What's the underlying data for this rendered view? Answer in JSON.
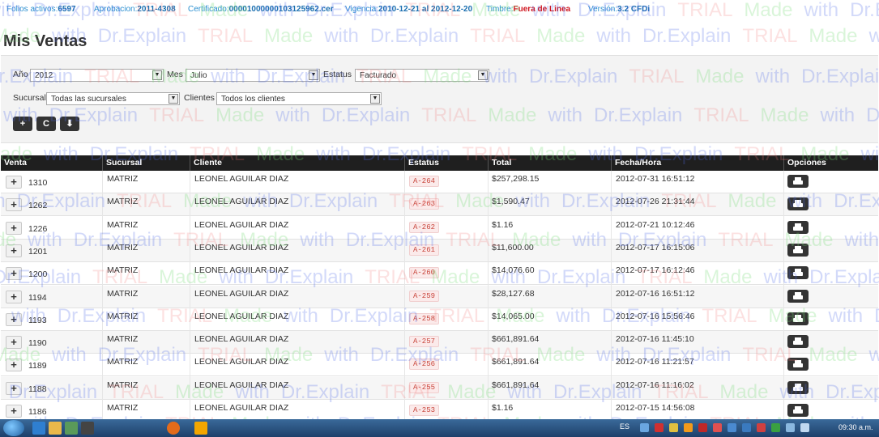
{
  "info": {
    "folios_label": "Folios activos:",
    "folios_value": "6597",
    "aprobacion_label": "Aprobacion:",
    "aprobacion_value": "2011-4308",
    "certificado_label": "Certificado:",
    "certificado_value": "00001000000103125962.cer",
    "vigencia_label": "Vigencia:",
    "vigencia_value": "2010-12-21 al 2012-12-20",
    "timbre_label": "Timbre:",
    "timbre_value": "Fuera de Linea",
    "version_label": "Versión:",
    "version_value": "3.2 CFDi"
  },
  "watermark": {
    "made": "Made",
    "with": "with",
    "drexplain": "Dr.Explain",
    "trial": "TRIAL"
  },
  "page_title": "Mis Ventas",
  "filters": {
    "anio_label": "Año",
    "anio_value": "2012",
    "mes_label": "Mes",
    "mes_value": "Julio",
    "estatus_label": "Estatus",
    "estatus_value": "Facturado",
    "sucursal_label": "Sucursal",
    "sucursal_value": "Todas las sucursales",
    "clientes_label": "Clientes",
    "clientes_value": "Todos los clientes"
  },
  "toolbar": {
    "add_glyph": "+",
    "refresh_glyph": "C",
    "download_glyph": "⬇"
  },
  "table": {
    "headers": [
      "Venta",
      "Sucursal",
      "Cliente",
      "Estatus",
      "Total",
      "Fecha/Hora",
      "Opciones"
    ],
    "rows": [
      {
        "venta": "1310",
        "sucursal": "MATRIZ",
        "cliente": "LEONEL AGUILAR DIAZ",
        "estatus": "A-264",
        "total": "$257,298.15",
        "fecha": "2012-07-31 16:51:12"
      },
      {
        "venta": "1262",
        "sucursal": "MATRIZ",
        "cliente": "LEONEL AGUILAR DIAZ",
        "estatus": "A-263",
        "total": "$1,590.47",
        "fecha": "2012-07-26 21:31:44"
      },
      {
        "venta": "1226",
        "sucursal": "MATRIZ",
        "cliente": "LEONEL AGUILAR DIAZ",
        "estatus": "A-262",
        "total": "$1.16",
        "fecha": "2012-07-21 10:12:46"
      },
      {
        "venta": "1201",
        "sucursal": "MATRIZ",
        "cliente": "LEONEL AGUILAR DIAZ",
        "estatus": "A-261",
        "total": "$11,600.00",
        "fecha": "2012-07-17 16:15:06"
      },
      {
        "venta": "1200",
        "sucursal": "MATRIZ",
        "cliente": "LEONEL AGUILAR DIAZ",
        "estatus": "A-260",
        "total": "$14,076.60",
        "fecha": "2012-07-17 16:12:46"
      },
      {
        "venta": "1194",
        "sucursal": "MATRIZ",
        "cliente": "LEONEL AGUILAR DIAZ",
        "estatus": "A-259",
        "total": "$28,127.68",
        "fecha": "2012-07-16 16:51:12"
      },
      {
        "venta": "1193",
        "sucursal": "MATRIZ",
        "cliente": "LEONEL AGUILAR DIAZ",
        "estatus": "A-258",
        "total": "$14,065.00",
        "fecha": "2012-07-16 15:56:46"
      },
      {
        "venta": "1190",
        "sucursal": "MATRIZ",
        "cliente": "LEONEL AGUILAR DIAZ",
        "estatus": "A-257",
        "total": "$661,891.64",
        "fecha": "2012-07-16 11:45:10"
      },
      {
        "venta": "1189",
        "sucursal": "MATRIZ",
        "cliente": "LEONEL AGUILAR DIAZ",
        "estatus": "A-256",
        "total": "$661,891.64",
        "fecha": "2012-07-16 11:21:57"
      },
      {
        "venta": "1188",
        "sucursal": "MATRIZ",
        "cliente": "LEONEL AGUILAR DIAZ",
        "estatus": "A-255",
        "total": "$661,891.64",
        "fecha": "2012-07-16 11:16:02"
      },
      {
        "venta": "1186",
        "sucursal": "MATRIZ",
        "cliente": "LEONEL AGUILAR DIAZ",
        "estatus": "A-253",
        "total": "$1.16",
        "fecha": "2012-07-15 14:56:08"
      }
    ]
  },
  "taskbar": {
    "language": "ES",
    "clock": "09:30 a.m."
  },
  "colors": {
    "header_bg": "#1f1f1f",
    "link_blue": "#2a8fd0",
    "status_red": "#c8443a",
    "timbre_red": "#d0141e"
  }
}
